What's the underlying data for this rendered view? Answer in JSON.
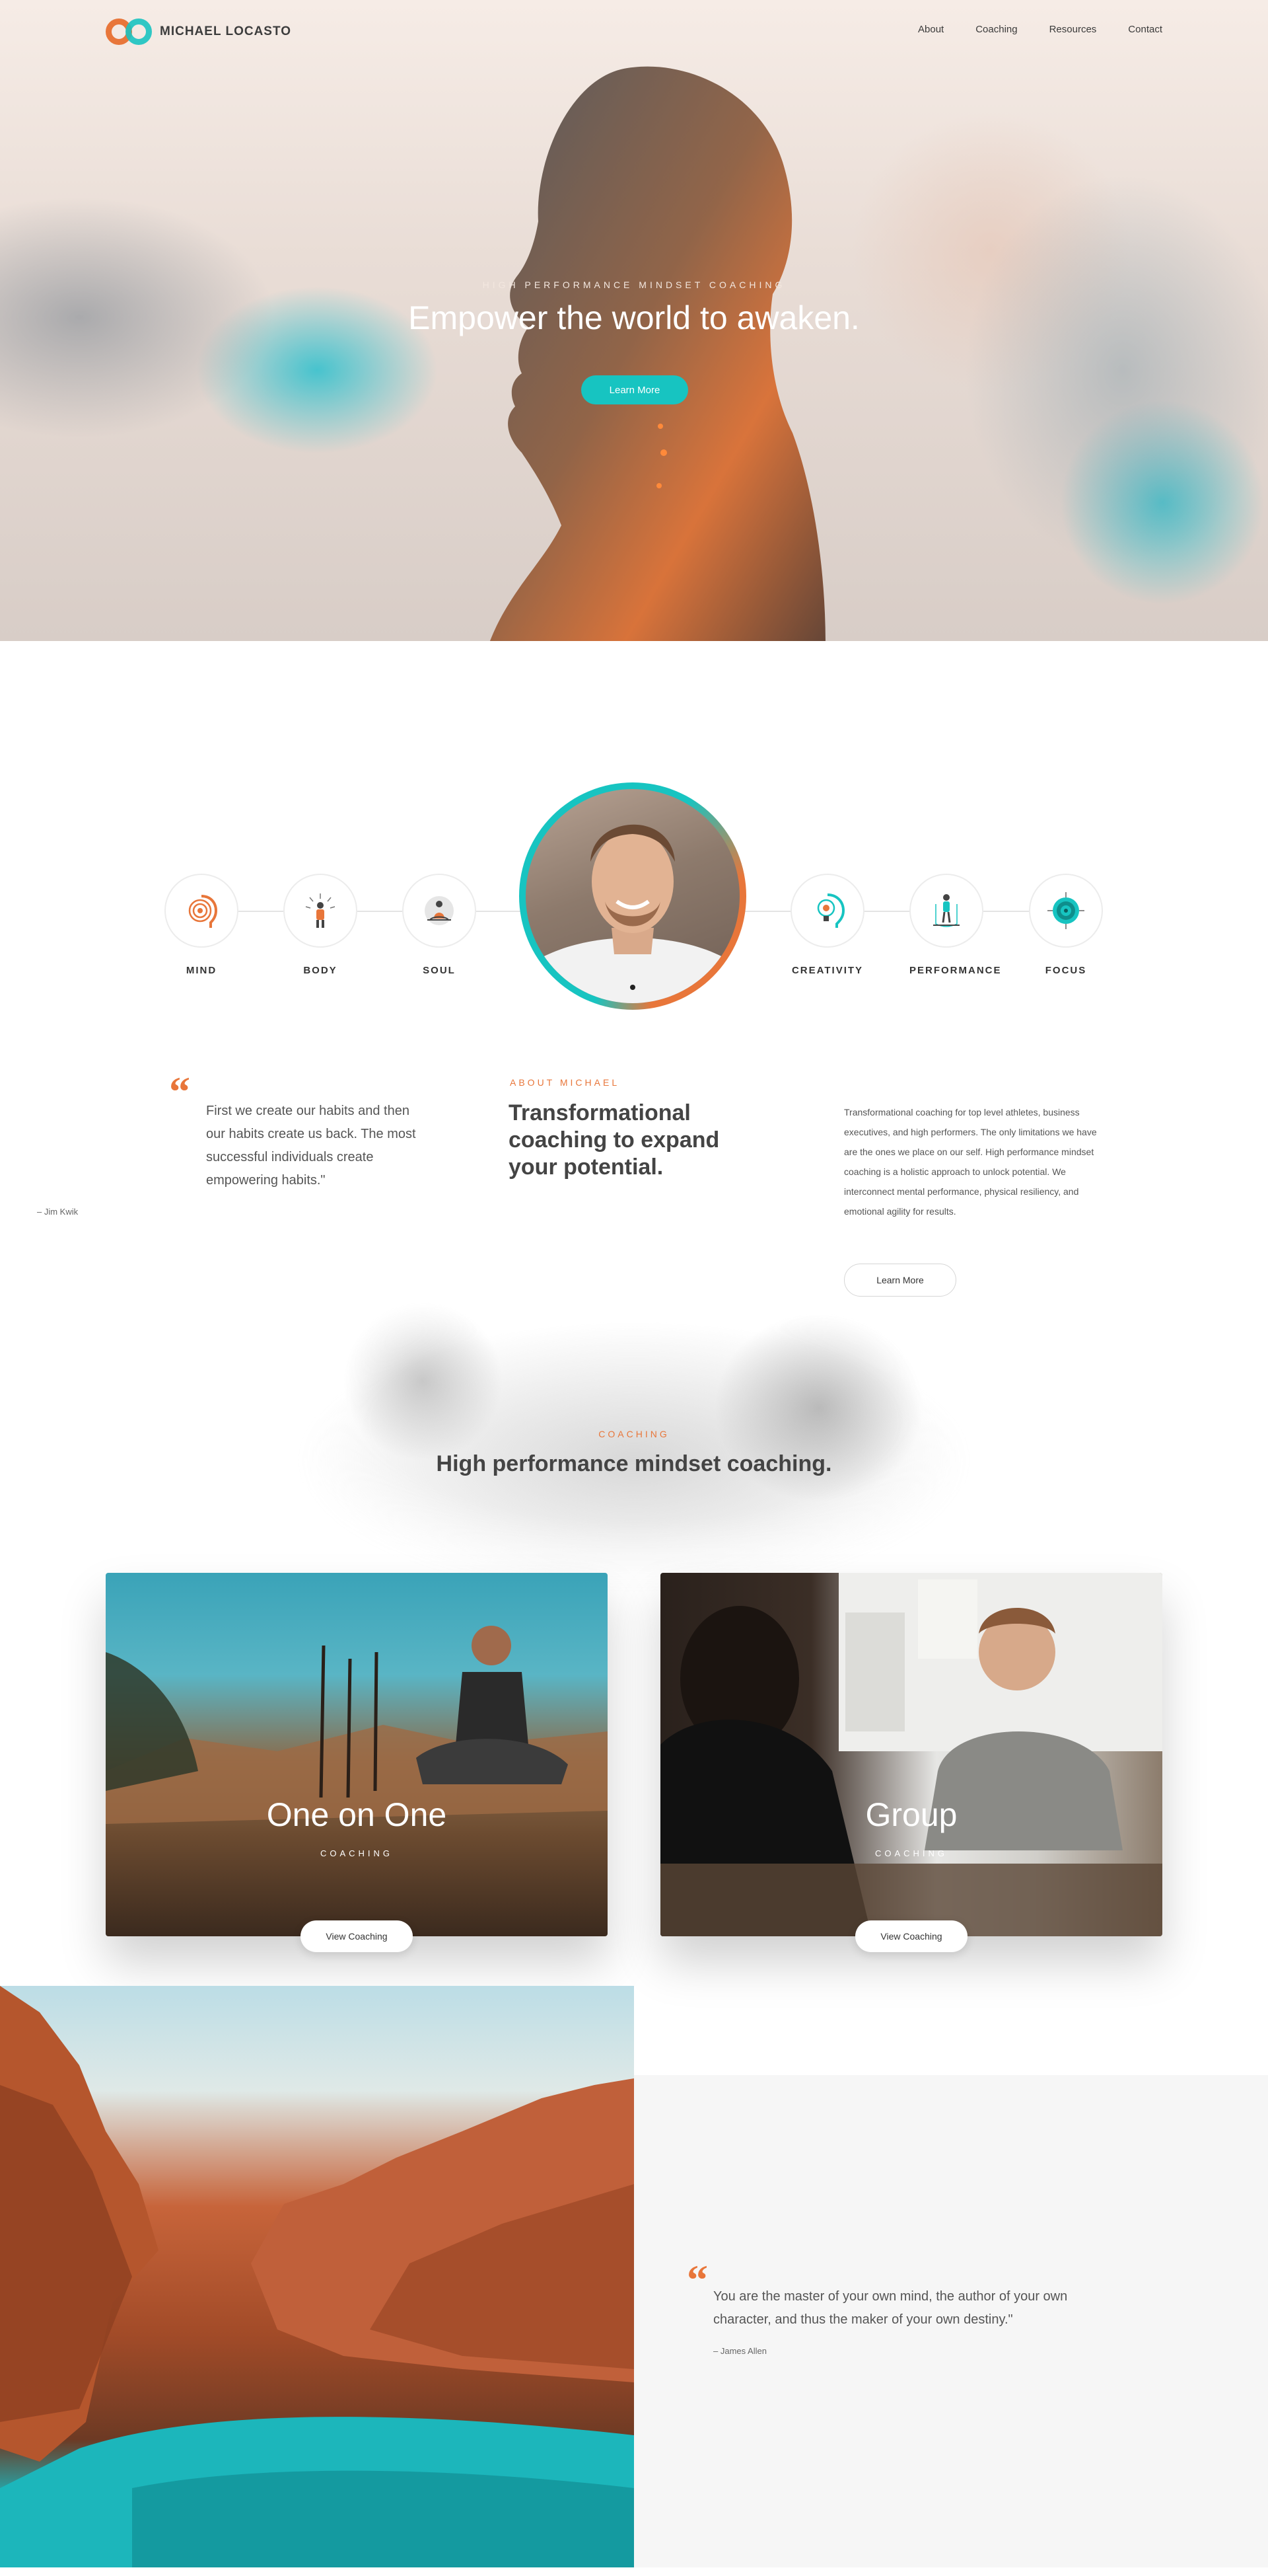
{
  "brand": {
    "name": "MICHAEL LOCASTO",
    "accent": "#e8763a",
    "teal": "#17c4c1"
  },
  "nav": {
    "items": [
      "About",
      "Coaching",
      "Resources",
      "Contact"
    ]
  },
  "hero": {
    "eyebrow": "HIGH PERFORMANCE MINDSET COACHING",
    "title": "Empower the world to awaken.",
    "button": "Learn More"
  },
  "pillars": {
    "left": [
      "MIND",
      "BODY",
      "SOUL"
    ],
    "right": [
      "CREATIVITY",
      "PERFORMANCE",
      "FOCUS"
    ]
  },
  "about": {
    "quote": "First we create our habits and then our habits create us back. The most successful individuals create empowering habits.\"",
    "quote_author": "– Jim Kwik",
    "eyebrow": "ABOUT MICHAEL",
    "heading": "Transformational coaching to expand your potential.",
    "body": "Transformational coaching for top level athletes, business executives, and high performers. The only limitations we have are the ones we place on our self. High performance mindset coaching is a holistic approach to unlock potential. We interconnect mental performance, physical resiliency, and emotional agility for results.",
    "button": "Learn More"
  },
  "coaching": {
    "eyebrow": "COACHING",
    "heading": "High performance mindset coaching.",
    "cards": [
      {
        "title": "One on One",
        "subtitle": "COACHING",
        "button": "View Coaching"
      },
      {
        "title": "Group",
        "subtitle": "COACHING",
        "button": "View Coaching"
      }
    ]
  },
  "final_quote": {
    "text": "You are the master of your own mind, the author of your own character, and thus the maker of your own destiny.\"",
    "author": "– James Allen"
  }
}
